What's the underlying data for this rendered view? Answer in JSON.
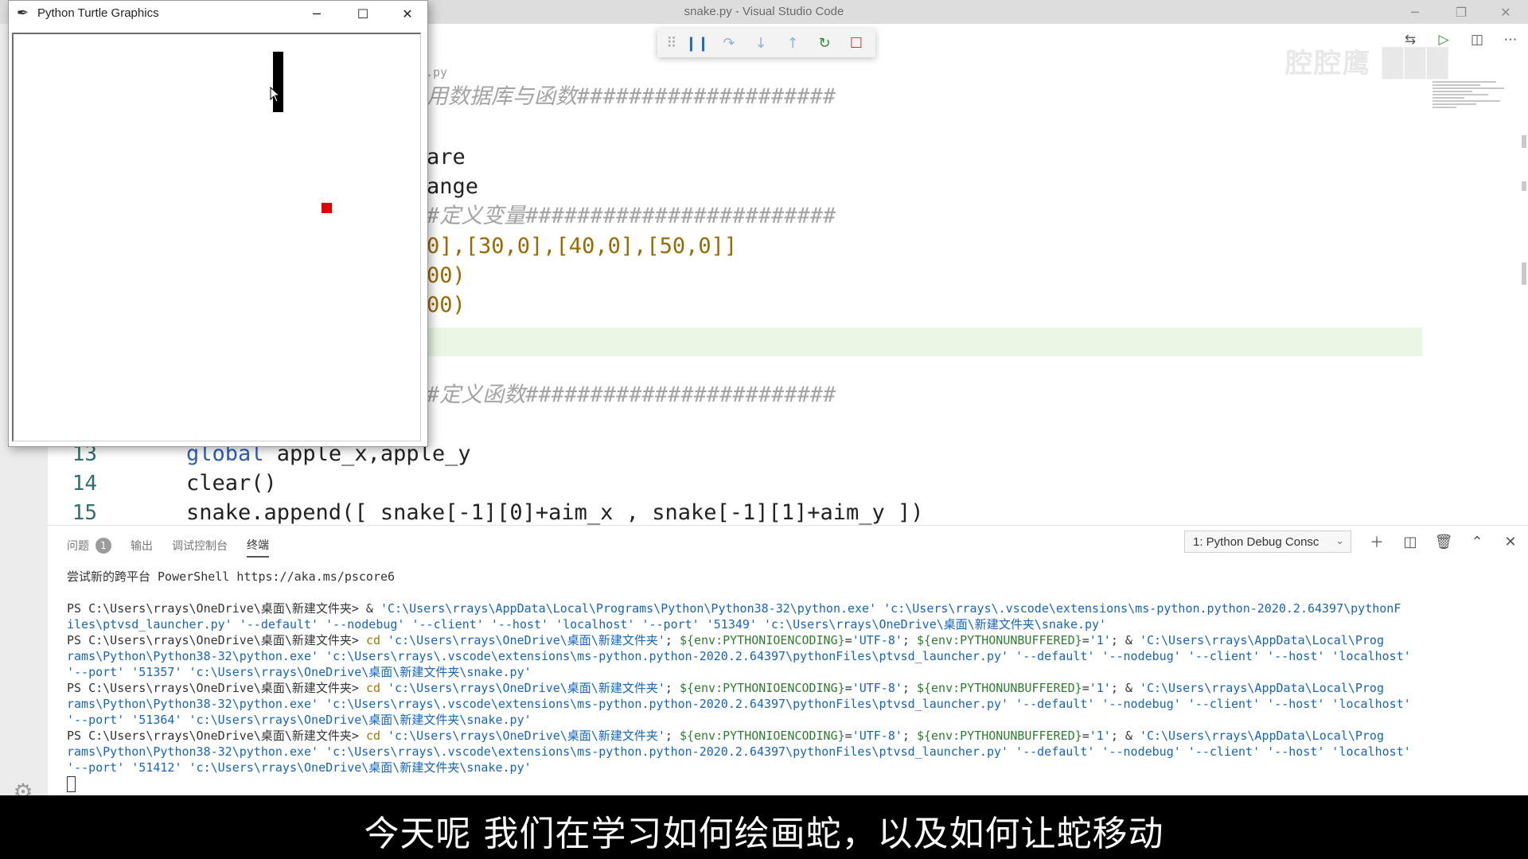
{
  "vscode": {
    "title": "snake.py - Visual Studio Code",
    "controls": [
      "─",
      "❐",
      "✕"
    ],
    "watermark": "腔腔鹰 ███"
  },
  "editor": {
    "filename": ".py",
    "lines": [
      {
        "text": "用数据库与函数####################",
        "cls": "c-comment"
      },
      {
        "text": "are",
        "cls": ""
      },
      {
        "text": "ange",
        "cls": ""
      },
      {
        "text": "#定义变量########################",
        "cls": "c-comment"
      },
      {
        "text": "0],[30,0],[40,0],[50,0]]",
        "cls": "c-bracket"
      },
      {
        "text": "00)",
        "cls": "c-bracket"
      },
      {
        "text": "00)",
        "cls": "c-bracket"
      },
      {
        "text": "#定义函数########################",
        "cls": "c-comment"
      }
    ],
    "numbered_lines": [
      {
        "num": "13",
        "kw": "global",
        "rest": " apple_x,apple_y"
      },
      {
        "num": "14",
        "kw": "",
        "rest": "clear()"
      },
      {
        "num": "15",
        "kw": "",
        "rest": "snake.append([ snake[-1][0]+aim_x , snake[-1][1]+aim_y ])"
      }
    ]
  },
  "debug_toolbar": {
    "buttons": [
      "grip-icon",
      "pause-icon",
      "step-over-icon",
      "step-into-icon",
      "step-out-icon",
      "restart-icon",
      "stop-icon"
    ]
  },
  "panel": {
    "tabs": [
      {
        "label": "问题",
        "badge": "1"
      },
      {
        "label": "输出"
      },
      {
        "label": "调试控制台"
      },
      {
        "label": "终端",
        "active": true
      }
    ],
    "terminal_select": "1: Python Debug Consc",
    "actions": [
      "add-icon",
      "split-icon",
      "trash-icon",
      "chevron-up-icon",
      "close-icon"
    ]
  },
  "terminal": {
    "lines": [
      {
        "segments": [
          {
            "t": "尝试新的跨平台 PowerShell https://aka.ms/pscore6",
            "c": ""
          }
        ]
      },
      {
        "gap": true
      },
      {
        "segments": [
          {
            "t": "PS C:\\Users\\rrays\\OneDrive\\桌面\\新建文件夹> & ",
            "c": ""
          },
          {
            "t": "'C:\\Users\\rrays\\AppData\\Local\\Programs\\Python\\Python38-32\\python.exe' 'c:\\Users\\rrays\\.vscode\\extensions\\ms-python.python-2020.2.64397\\pythonF",
            "c": "t-blue"
          }
        ]
      },
      {
        "segments": [
          {
            "t": "iles\\ptvsd_launcher.py' '--default' '--nodebug' '--client' '--host' 'localhost' '--port' '51349' 'c:\\Users\\rrays\\OneDrive\\桌面\\新建文件夹\\snake.py'",
            "c": "t-blue"
          }
        ]
      },
      {
        "segments": [
          {
            "t": "PS C:\\Users\\rrays\\OneDrive\\桌面\\新建文件夹> ",
            "c": ""
          },
          {
            "t": "cd ",
            "c": "t-gold"
          },
          {
            "t": "'c:\\Users\\rrays\\OneDrive\\桌面\\新建文件夹'",
            "c": "t-blue"
          },
          {
            "t": "; ",
            "c": ""
          },
          {
            "t": "${env:PYTHONIOENCODING}",
            "c": "t-green"
          },
          {
            "t": "=",
            "c": ""
          },
          {
            "t": "'UTF-8'",
            "c": "t-blue"
          },
          {
            "t": "; ",
            "c": ""
          },
          {
            "t": "${env:PYTHONUNBUFFERED}",
            "c": "t-green"
          },
          {
            "t": "=",
            "c": ""
          },
          {
            "t": "'1'",
            "c": "t-blue"
          },
          {
            "t": "; & ",
            "c": ""
          },
          {
            "t": "'C:\\Users\\rrays\\AppData\\Local\\Prog",
            "c": "t-blue"
          }
        ]
      },
      {
        "segments": [
          {
            "t": "rams\\Python\\Python38-32\\python.exe' 'c:\\Users\\rrays\\.vscode\\extensions\\ms-python.python-2020.2.64397\\pythonFiles\\ptvsd_launcher.py' '--default' '--nodebug' '--client' '--host' 'localhost'",
            "c": "t-blue"
          }
        ]
      },
      {
        "segments": [
          {
            "t": "'--port' '51357' 'c:\\Users\\rrays\\OneDrive\\桌面\\新建文件夹\\snake.py'",
            "c": "t-blue"
          }
        ]
      },
      {
        "segments": [
          {
            "t": "PS C:\\Users\\rrays\\OneDrive\\桌面\\新建文件夹> ",
            "c": ""
          },
          {
            "t": "cd ",
            "c": "t-gold"
          },
          {
            "t": "'c:\\Users\\rrays\\OneDrive\\桌面\\新建文件夹'",
            "c": "t-blue"
          },
          {
            "t": "; ",
            "c": ""
          },
          {
            "t": "${env:PYTHONIOENCODING}",
            "c": "t-green"
          },
          {
            "t": "=",
            "c": ""
          },
          {
            "t": "'UTF-8'",
            "c": "t-blue"
          },
          {
            "t": "; ",
            "c": ""
          },
          {
            "t": "${env:PYTHONUNBUFFERED}",
            "c": "t-green"
          },
          {
            "t": "=",
            "c": ""
          },
          {
            "t": "'1'",
            "c": "t-blue"
          },
          {
            "t": "; & ",
            "c": ""
          },
          {
            "t": "'C:\\Users\\rrays\\AppData\\Local\\Prog",
            "c": "t-blue"
          }
        ]
      },
      {
        "segments": [
          {
            "t": "rams\\Python\\Python38-32\\python.exe' 'c:\\Users\\rrays\\.vscode\\extensions\\ms-python.python-2020.2.64397\\pythonFiles\\ptvsd_launcher.py' '--default' '--nodebug' '--client' '--host' 'localhost'",
            "c": "t-blue"
          }
        ]
      },
      {
        "segments": [
          {
            "t": "'--port' '51364' 'c:\\Users\\rrays\\OneDrive\\桌面\\新建文件夹\\snake.py'",
            "c": "t-blue"
          }
        ]
      },
      {
        "segments": [
          {
            "t": "PS C:\\Users\\rrays\\OneDrive\\桌面\\新建文件夹> ",
            "c": ""
          },
          {
            "t": "cd ",
            "c": "t-gold"
          },
          {
            "t": "'c:\\Users\\rrays\\OneDrive\\桌面\\新建文件夹'",
            "c": "t-blue"
          },
          {
            "t": "; ",
            "c": ""
          },
          {
            "t": "${env:PYTHONIOENCODING}",
            "c": "t-green"
          },
          {
            "t": "=",
            "c": ""
          },
          {
            "t": "'UTF-8'",
            "c": "t-blue"
          },
          {
            "t": "; ",
            "c": ""
          },
          {
            "t": "${env:PYTHONUNBUFFERED}",
            "c": "t-green"
          },
          {
            "t": "=",
            "c": ""
          },
          {
            "t": "'1'",
            "c": "t-blue"
          },
          {
            "t": "; & ",
            "c": ""
          },
          {
            "t": "'C:\\Users\\rrays\\AppData\\Local\\Prog",
            "c": "t-blue"
          }
        ]
      },
      {
        "segments": [
          {
            "t": "rams\\Python\\Python38-32\\python.exe' 'c:\\Users\\rrays\\.vscode\\extensions\\ms-python.python-2020.2.64397\\pythonFiles\\ptvsd_launcher.py' '--default' '--nodebug' '--client' '--host' 'localhost'",
            "c": "t-blue"
          }
        ]
      },
      {
        "segments": [
          {
            "t": "'--port' '51412' 'c:\\Users\\rrays\\OneDrive\\桌面\\新建文件夹\\snake.py'",
            "c": "t-blue"
          }
        ]
      }
    ]
  },
  "turtle_window": {
    "title": "Python Turtle Graphics",
    "controls": [
      "─",
      "☐",
      "✕"
    ]
  },
  "subtitle": "今天呢 我们在学习如何绘画蛇，以及如何让蛇移动",
  "colors": {
    "apple": "#e60000",
    "snake": "#000000",
    "current_line": "#ebf7e4"
  }
}
